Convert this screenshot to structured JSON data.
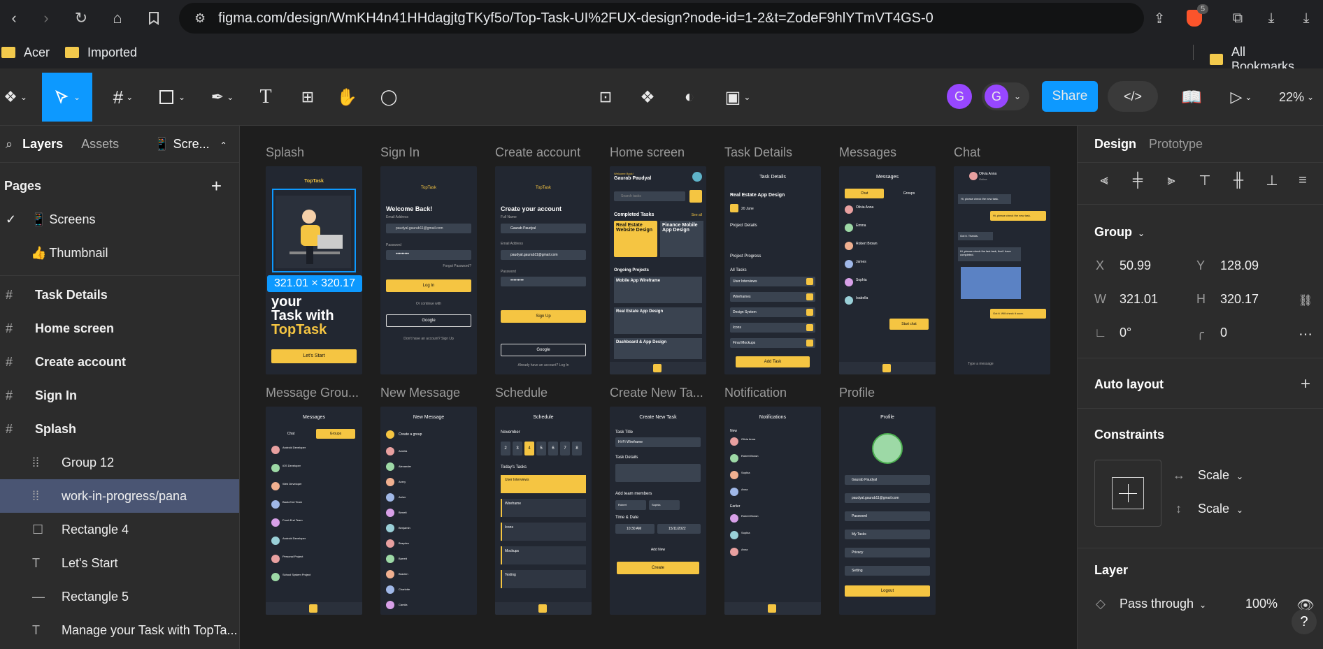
{
  "browser": {
    "url": "figma.com/design/WmKH4n41HHdagjtgTKyf5o/Top-Task-UI%2FUX-design?node-id=1-2&t=ZodeF9hlYTmVT4GS-0",
    "brave_badge": "5"
  },
  "bookmarks": {
    "items": [
      "Acer",
      "Imported"
    ],
    "all": "All Bookmarks"
  },
  "toolbar": {
    "share": "Share",
    "zoom": "22%",
    "avatar": "G"
  },
  "left": {
    "tabs": [
      "Layers",
      "Assets"
    ],
    "file_tab": "Scre...",
    "pages_label": "Pages",
    "pages": [
      {
        "emoji": "📱",
        "label": "Screens"
      },
      {
        "emoji": "👍",
        "label": "Thumbnail"
      }
    ],
    "layers": [
      {
        "icon": "#",
        "label": "Task Details",
        "bold": true
      },
      {
        "icon": "#",
        "label": "Home screen",
        "bold": true
      },
      {
        "icon": "#",
        "label": "Create account",
        "bold": true
      },
      {
        "icon": "#",
        "label": "Sign In",
        "bold": true
      },
      {
        "icon": "#",
        "label": "Splash",
        "bold": true
      },
      {
        "icon": "group",
        "label": "Group 12"
      },
      {
        "icon": "group",
        "label": "work-in-progress/pana",
        "selected": true
      },
      {
        "icon": "rect",
        "label": "Rectangle 4"
      },
      {
        "icon": "T",
        "label": "Let's Start"
      },
      {
        "icon": "line",
        "label": "Rectangle 5"
      },
      {
        "icon": "T",
        "label": "Manage your Task with TopTa..."
      }
    ]
  },
  "canvas": {
    "row1": [
      "Splash",
      "Sign In",
      "Create account",
      "Home screen",
      "Task Details",
      "Messages",
      "Chat"
    ],
    "row2": [
      "Message Grou...",
      "New Message",
      "Schedule",
      "Create New Ta...",
      "Notification",
      "Profile"
    ],
    "selection": "321.01 × 320.17",
    "splash": {
      "logo": "TopTask",
      "title1": "your",
      "title2": "Task with",
      "title3": "TopTask",
      "button": "Let's Start"
    },
    "signin": {
      "title": "Welcome Back!",
      "email_label": "Email Address",
      "email": "paudyal.gaurab11@gmail.com",
      "password_label": "Password",
      "password": "•••••••••",
      "forgot": "Forgot Password?",
      "login": "Log In",
      "or": "Or continue with",
      "google": "Google",
      "footer": "Don't have an account? Sign Up"
    },
    "create": {
      "title": "Create your account",
      "name_label": "Full Name",
      "name": "Gaurab Paudyal",
      "email_label": "Email Address",
      "email": "paudyal.gaurab11@gmail.com",
      "password_label": "Password",
      "password": "•••••••••",
      "signup": "Sign Up",
      "google": "Google",
      "footer": "Already have an account? Log In"
    },
    "home": {
      "welcome": "Welcome Back!",
      "name": "Gaurab Paudyal",
      "search": "Search tasks",
      "completed": "Completed Tasks",
      "see_all": "See all",
      "card1": "Real Estate Website Design",
      "card2": "Finance Mobile App Design",
      "ongoing": "Ongoing Projects",
      "proj": [
        "Mobile App Wireframe",
        "Real Estate App Design",
        "Dashboard & App Design"
      ]
    },
    "task": {
      "header": "Task Details",
      "title": "Real Estate App Design",
      "due": "20 June",
      "details": "Project Details",
      "progress": "Project Progress",
      "all": "All Tasks",
      "items": [
        "User Interviews",
        "Wireframes",
        "Design System",
        "Icons",
        "Final Mockups"
      ],
      "button": "Add Task"
    },
    "messages": {
      "header": "Messages",
      "tabs": [
        "Chat",
        "Groups"
      ],
      "names": [
        "Olivia Anna",
        "Emma",
        "Robert Brown",
        "James",
        "Sophia",
        "Isabella"
      ],
      "button": "Start chat"
    },
    "chat": {
      "name": "Olivia Anna",
      "status": "Online",
      "bubbles": [
        "Hi, please check the new task.",
        "Hi, please check the new task.",
        "Got it. Thanks.",
        "Hi, please check the last task, that I have completed.",
        "Got it. Will check it soon."
      ],
      "input": "Type a message"
    },
    "groups": {
      "header": "Messages",
      "tabs": [
        "Chat",
        "Groups"
      ],
      "names": [
        "Android Developer",
        "iOS Developer",
        "Web Developer",
        "Back-End Team",
        "Front-End Team",
        "Android Developer",
        "Personal Project",
        "School System Project"
      ]
    },
    "newmsg": {
      "header": "New Message",
      "group": "Create a group",
      "names": [
        "Amelia",
        "Alexander",
        "Avery",
        "Asher",
        "Benett",
        "Benjamin",
        "Brayden",
        "Barrett",
        "Bravien",
        "Charlotte",
        "Camila"
      ]
    },
    "schedule": {
      "header": "Schedule",
      "month": "November",
      "days": [
        "2",
        "3",
        "4",
        "5",
        "6",
        "7",
        "8"
      ],
      "today": "Today's Tasks",
      "items": [
        "User Interviews",
        "Wireframe",
        "Icons",
        "Mockups",
        "Testing"
      ]
    },
    "newtask": {
      "header": "Create New Task",
      "title_label": "Task Title",
      "title": "Hi-Fi Wireframe",
      "details_label": "Task Details",
      "members": "Add team members",
      "m1": "Robert",
      "m2": "Sophia",
      "time": "Time & Date",
      "clock": "10:30 AM",
      "date": "15/11/2022",
      "addnew": "Add New",
      "create": "Create"
    },
    "notif": {
      "header": "Notifications",
      "new": "New",
      "earlier": "Earlier",
      "names": [
        "Olivia Anna",
        "Robert Brown",
        "Sophia",
        "Anna",
        "Robert Brown",
        "Sophia",
        "Anna"
      ]
    },
    "profile": {
      "header": "Profile",
      "name": "Gaurab Paudyal",
      "email": "paudyal.gaurab11@gmail.com",
      "password": "Password",
      "tasks": "My Tasks",
      "privacy": "Privacy",
      "setting": "Setting",
      "logout": "Logout"
    }
  },
  "right": {
    "tabs": [
      "Design",
      "Prototype"
    ],
    "group": "Group",
    "x_l": "X",
    "x": "50.99",
    "y_l": "Y",
    "y": "128.09",
    "w_l": "W",
    "w": "321.01",
    "h_l": "H",
    "h": "320.17",
    "rot": "0°",
    "radius": "0",
    "autolayout": "Auto layout",
    "constraints": "Constraints",
    "c_h": "Scale",
    "c_v": "Scale",
    "layer": "Layer",
    "blend": "Pass through",
    "opacity": "100%",
    "help": "?"
  }
}
